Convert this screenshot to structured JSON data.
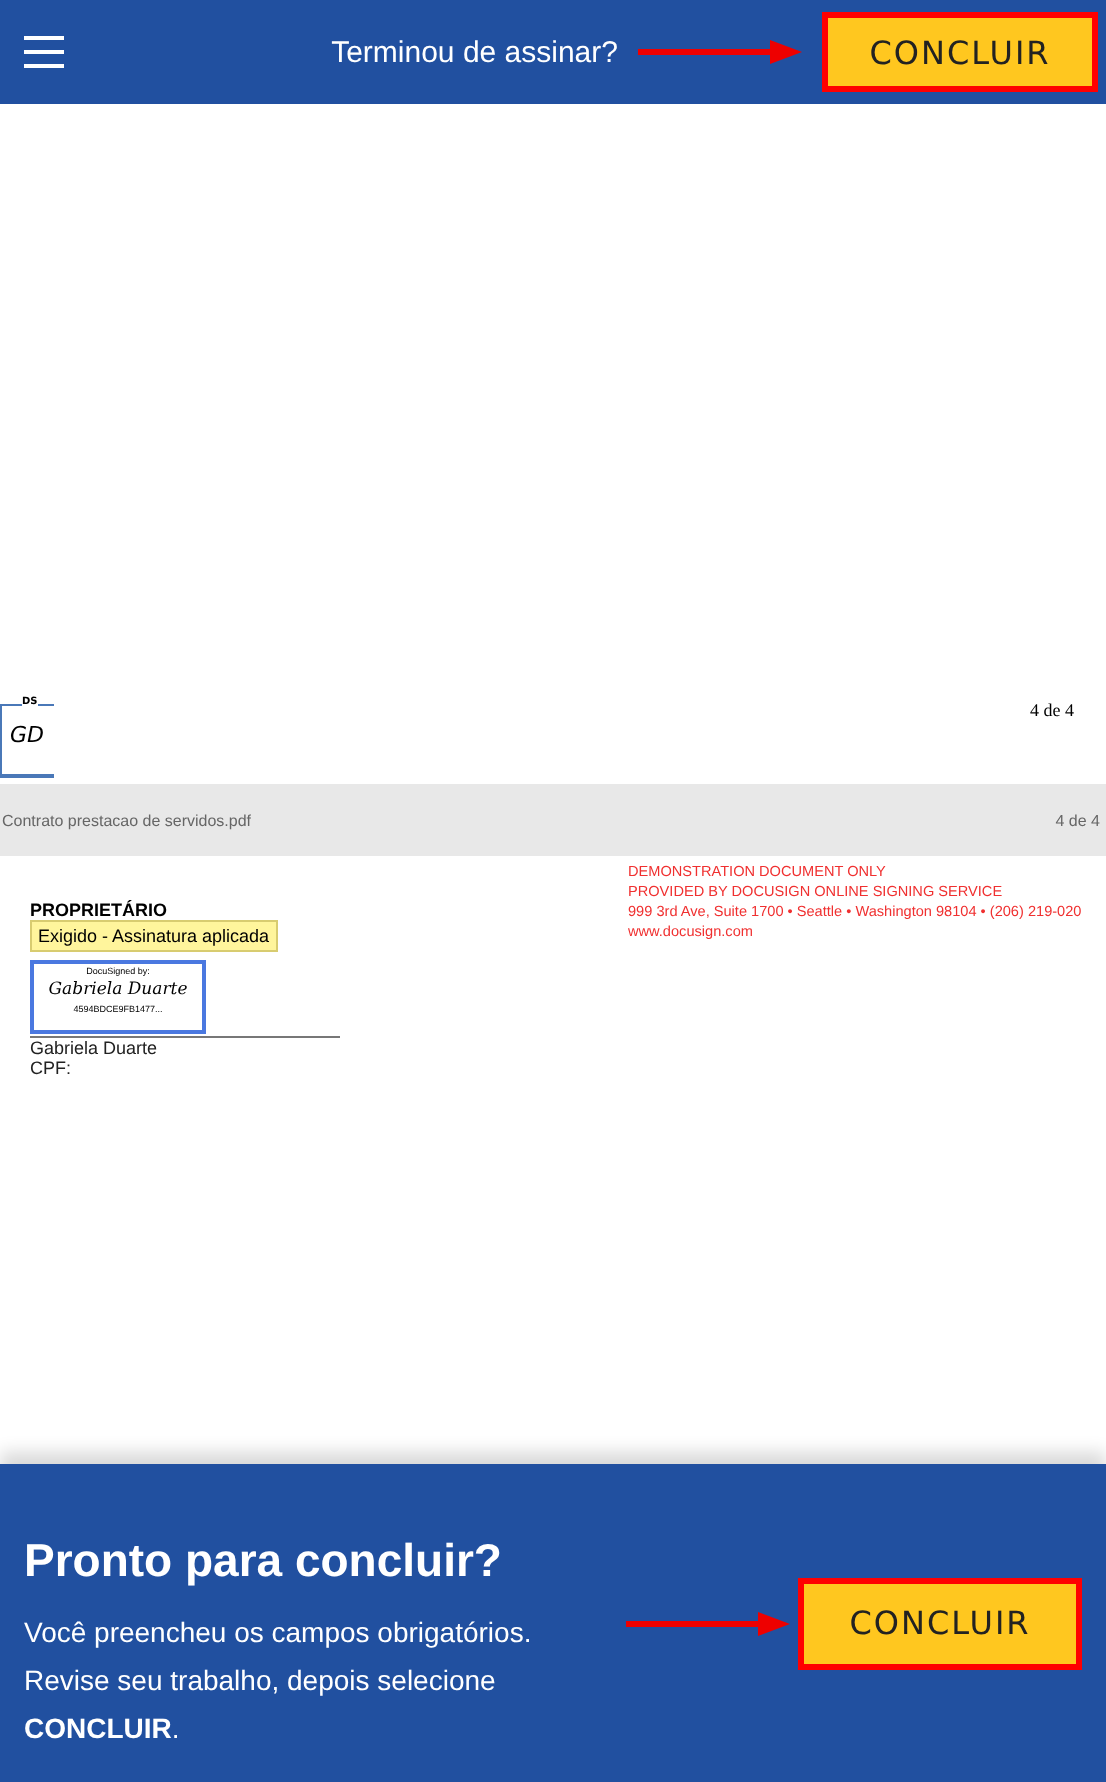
{
  "header": {
    "title": "Terminou de assinar?",
    "button": "CONCLUIR"
  },
  "page_end": {
    "initials_tag": "DS",
    "initials": "GD",
    "page_number": "4 de 4"
  },
  "file_bar": {
    "filename": "Contrato prestacao de servidos.pdf",
    "page_number": "4 de 4"
  },
  "page": {
    "role_label": "PROPRIETÁRIO",
    "tooltip": "Exigido - Assinatura aplicada",
    "signature": {
      "caption": "DocuSigned by:",
      "name": "Gabriela Duarte",
      "id": "4594BDCE9FB1477..."
    },
    "signer_name": "Gabriela Duarte",
    "cpf_label": "CPF:",
    "demo_notice": [
      "DEMONSTRATION DOCUMENT ONLY",
      "PROVIDED BY DOCUSIGN ONLINE SIGNING SERVICE",
      "999 3rd Ave, Suite 1700  • Seattle • Washington 98104 • (206) 219-020",
      "www.docusign.com"
    ]
  },
  "footer": {
    "title": "Pronto para concluir?",
    "message": "Você preencheu os campos obrigatórios. Revise seu trabalho, depois selecione **CONCLUIR**.",
    "button": "CONCLUIR"
  }
}
